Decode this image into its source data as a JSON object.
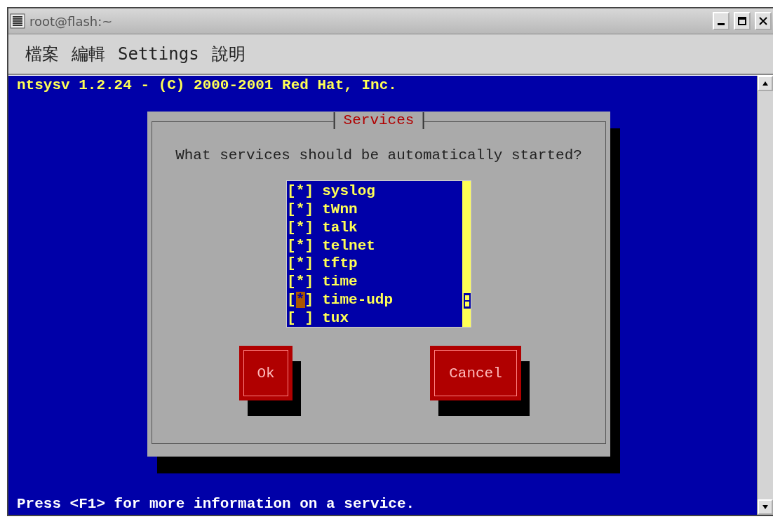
{
  "window": {
    "title": "root@flash:~"
  },
  "menu": [
    "檔案",
    "編輯",
    "Settings",
    "說明"
  ],
  "terminal": {
    "header": "ntsysv 1.2.24 - (C) 2000-2001 Red Hat, Inc.",
    "footer": "Press <F1> for more information on a service."
  },
  "dialog": {
    "title": "Services",
    "prompt": "What services should be automatically started?",
    "checkbox": {
      "open": "[",
      "close": "]",
      "mark": "*"
    },
    "services": [
      {
        "name": "syslog",
        "checked": true,
        "selected": false
      },
      {
        "name": "tWnn",
        "checked": true,
        "selected": false
      },
      {
        "name": "talk",
        "checked": true,
        "selected": false
      },
      {
        "name": "telnet",
        "checked": true,
        "selected": false
      },
      {
        "name": "tftp",
        "checked": true,
        "selected": false
      },
      {
        "name": "time",
        "checked": true,
        "selected": false
      },
      {
        "name": "time-udp",
        "checked": true,
        "selected": true
      },
      {
        "name": "tux",
        "checked": false,
        "selected": false
      }
    ],
    "buttons": [
      {
        "label": "Ok"
      },
      {
        "label": "Cancel"
      }
    ]
  }
}
